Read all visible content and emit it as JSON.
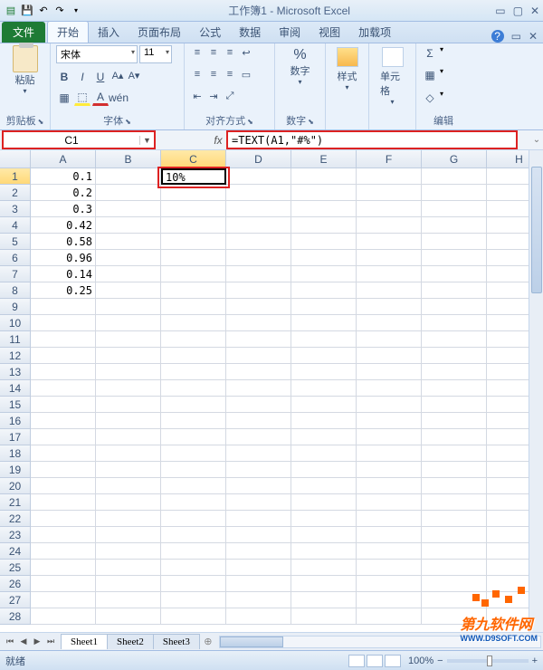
{
  "title": "工作簿1 - Microsoft Excel",
  "qat": {
    "save": "💾",
    "undo": "↶",
    "redo": "↷",
    "dd": "▾"
  },
  "win": {
    "min": "▭",
    "max": "▢",
    "close": "✕"
  },
  "tabs": {
    "file": "文件",
    "items": [
      "开始",
      "插入",
      "页面布局",
      "公式",
      "数据",
      "审阅",
      "视图",
      "加载项"
    ],
    "help": "?",
    "inner_min": "▭",
    "inner_close": "✕"
  },
  "ribbon": {
    "clipboard": {
      "paste": "粘贴",
      "label": "剪贴板"
    },
    "font": {
      "name": "宋体",
      "size": "11",
      "bold": "B",
      "italic": "I",
      "underline": "U",
      "label": "字体"
    },
    "align": {
      "label": "对齐方式"
    },
    "number": {
      "btn": "数字",
      "pct": "%",
      "comma": ",",
      "label": "数字"
    },
    "styles": {
      "btn": "样式"
    },
    "cells": {
      "btn": "单元格"
    },
    "editing": {
      "sigma": "Σ",
      "fill": "▦",
      "clear": "◇",
      "label": "编辑"
    }
  },
  "name_box": "C1",
  "fx": "fx",
  "formula": "=TEXT(A1,\"#%\")",
  "columns": [
    "A",
    "B",
    "C",
    "D",
    "E",
    "F",
    "G",
    "H"
  ],
  "rows": [
    1,
    2,
    3,
    4,
    5,
    6,
    7,
    8,
    9,
    10,
    11,
    12,
    13,
    14,
    15,
    16,
    17,
    18,
    19,
    20,
    21,
    22,
    23,
    24,
    25,
    26,
    27,
    28
  ],
  "data_a": [
    "0.1",
    "0.2",
    "0.3",
    "0.42",
    "0.58",
    "0.96",
    "0.14",
    "0.25"
  ],
  "data_c1": "10%",
  "selected_col": "C",
  "selected_row": 1,
  "sheets": {
    "nav": [
      "⏮",
      "◀",
      "▶",
      "⏭"
    ],
    "tabs": [
      "Sheet1",
      "Sheet2",
      "Sheet3"
    ],
    "new": "⊕"
  },
  "status": {
    "ready": "就绪",
    "zoom": "100%",
    "minus": "−",
    "plus": "+"
  },
  "watermark": {
    "main": "第九软件网",
    "sub": "WWW.D9SOFT.COM"
  }
}
